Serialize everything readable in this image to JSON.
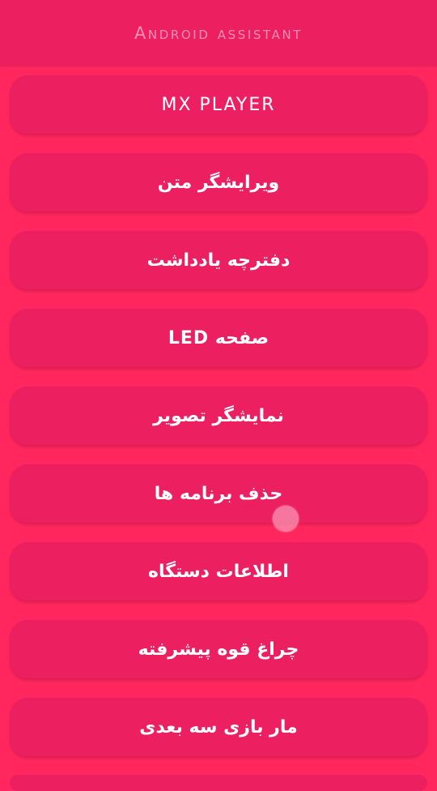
{
  "header": {
    "title": "Android assistant"
  },
  "menu": {
    "items": [
      {
        "label": "MX PLAYER"
      },
      {
        "label": "ویرایشگر متن"
      },
      {
        "label": "دفترچه یادداشت"
      },
      {
        "label": "صفحه LED"
      },
      {
        "label": "نمایشگر تصویر"
      },
      {
        "label": "حذف برنامه ها"
      },
      {
        "label": "اطلاعات دستگاه"
      },
      {
        "label": "چراغ قوه پیشرفته"
      },
      {
        "label": "مار بازی سه بعدی"
      }
    ]
  },
  "colors": {
    "background": "#FF275E",
    "header": "#EC1F61",
    "button": "#EC1F61",
    "header_text": "#FF8FB2",
    "button_text": "#FFFFFF"
  }
}
